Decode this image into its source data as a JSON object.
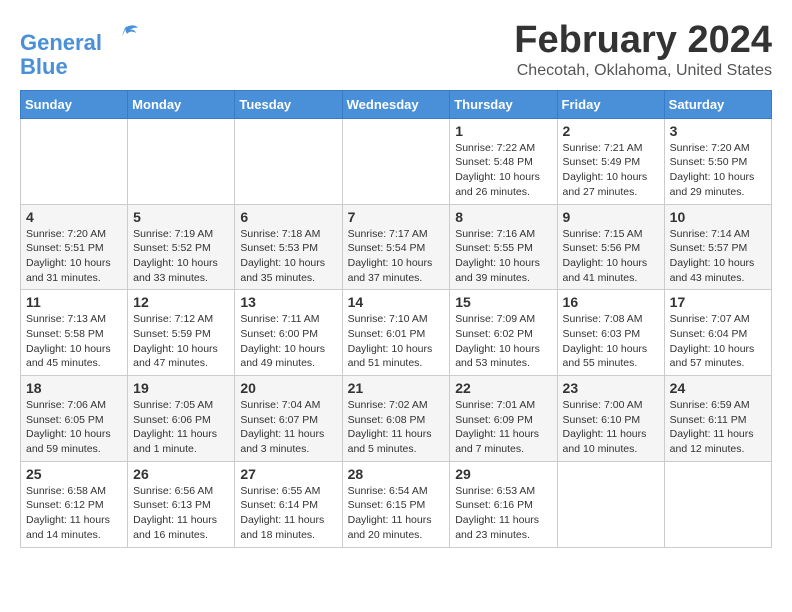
{
  "logo": {
    "line1": "General",
    "line2": "Blue"
  },
  "title": "February 2024",
  "subtitle": "Checotah, Oklahoma, United States",
  "days_of_week": [
    "Sunday",
    "Monday",
    "Tuesday",
    "Wednesday",
    "Thursday",
    "Friday",
    "Saturday"
  ],
  "weeks": [
    [
      {
        "day": "",
        "info": ""
      },
      {
        "day": "",
        "info": ""
      },
      {
        "day": "",
        "info": ""
      },
      {
        "day": "",
        "info": ""
      },
      {
        "day": "1",
        "info": "Sunrise: 7:22 AM\nSunset: 5:48 PM\nDaylight: 10 hours and 26 minutes."
      },
      {
        "day": "2",
        "info": "Sunrise: 7:21 AM\nSunset: 5:49 PM\nDaylight: 10 hours and 27 minutes."
      },
      {
        "day": "3",
        "info": "Sunrise: 7:20 AM\nSunset: 5:50 PM\nDaylight: 10 hours and 29 minutes."
      }
    ],
    [
      {
        "day": "4",
        "info": "Sunrise: 7:20 AM\nSunset: 5:51 PM\nDaylight: 10 hours and 31 minutes."
      },
      {
        "day": "5",
        "info": "Sunrise: 7:19 AM\nSunset: 5:52 PM\nDaylight: 10 hours and 33 minutes."
      },
      {
        "day": "6",
        "info": "Sunrise: 7:18 AM\nSunset: 5:53 PM\nDaylight: 10 hours and 35 minutes."
      },
      {
        "day": "7",
        "info": "Sunrise: 7:17 AM\nSunset: 5:54 PM\nDaylight: 10 hours and 37 minutes."
      },
      {
        "day": "8",
        "info": "Sunrise: 7:16 AM\nSunset: 5:55 PM\nDaylight: 10 hours and 39 minutes."
      },
      {
        "day": "9",
        "info": "Sunrise: 7:15 AM\nSunset: 5:56 PM\nDaylight: 10 hours and 41 minutes."
      },
      {
        "day": "10",
        "info": "Sunrise: 7:14 AM\nSunset: 5:57 PM\nDaylight: 10 hours and 43 minutes."
      }
    ],
    [
      {
        "day": "11",
        "info": "Sunrise: 7:13 AM\nSunset: 5:58 PM\nDaylight: 10 hours and 45 minutes."
      },
      {
        "day": "12",
        "info": "Sunrise: 7:12 AM\nSunset: 5:59 PM\nDaylight: 10 hours and 47 minutes."
      },
      {
        "day": "13",
        "info": "Sunrise: 7:11 AM\nSunset: 6:00 PM\nDaylight: 10 hours and 49 minutes."
      },
      {
        "day": "14",
        "info": "Sunrise: 7:10 AM\nSunset: 6:01 PM\nDaylight: 10 hours and 51 minutes."
      },
      {
        "day": "15",
        "info": "Sunrise: 7:09 AM\nSunset: 6:02 PM\nDaylight: 10 hours and 53 minutes."
      },
      {
        "day": "16",
        "info": "Sunrise: 7:08 AM\nSunset: 6:03 PM\nDaylight: 10 hours and 55 minutes."
      },
      {
        "day": "17",
        "info": "Sunrise: 7:07 AM\nSunset: 6:04 PM\nDaylight: 10 hours and 57 minutes."
      }
    ],
    [
      {
        "day": "18",
        "info": "Sunrise: 7:06 AM\nSunset: 6:05 PM\nDaylight: 10 hours and 59 minutes."
      },
      {
        "day": "19",
        "info": "Sunrise: 7:05 AM\nSunset: 6:06 PM\nDaylight: 11 hours and 1 minute."
      },
      {
        "day": "20",
        "info": "Sunrise: 7:04 AM\nSunset: 6:07 PM\nDaylight: 11 hours and 3 minutes."
      },
      {
        "day": "21",
        "info": "Sunrise: 7:02 AM\nSunset: 6:08 PM\nDaylight: 11 hours and 5 minutes."
      },
      {
        "day": "22",
        "info": "Sunrise: 7:01 AM\nSunset: 6:09 PM\nDaylight: 11 hours and 7 minutes."
      },
      {
        "day": "23",
        "info": "Sunrise: 7:00 AM\nSunset: 6:10 PM\nDaylight: 11 hours and 10 minutes."
      },
      {
        "day": "24",
        "info": "Sunrise: 6:59 AM\nSunset: 6:11 PM\nDaylight: 11 hours and 12 minutes."
      }
    ],
    [
      {
        "day": "25",
        "info": "Sunrise: 6:58 AM\nSunset: 6:12 PM\nDaylight: 11 hours and 14 minutes."
      },
      {
        "day": "26",
        "info": "Sunrise: 6:56 AM\nSunset: 6:13 PM\nDaylight: 11 hours and 16 minutes."
      },
      {
        "day": "27",
        "info": "Sunrise: 6:55 AM\nSunset: 6:14 PM\nDaylight: 11 hours and 18 minutes."
      },
      {
        "day": "28",
        "info": "Sunrise: 6:54 AM\nSunset: 6:15 PM\nDaylight: 11 hours and 20 minutes."
      },
      {
        "day": "29",
        "info": "Sunrise: 6:53 AM\nSunset: 6:16 PM\nDaylight: 11 hours and 23 minutes."
      },
      {
        "day": "",
        "info": ""
      },
      {
        "day": "",
        "info": ""
      }
    ]
  ]
}
